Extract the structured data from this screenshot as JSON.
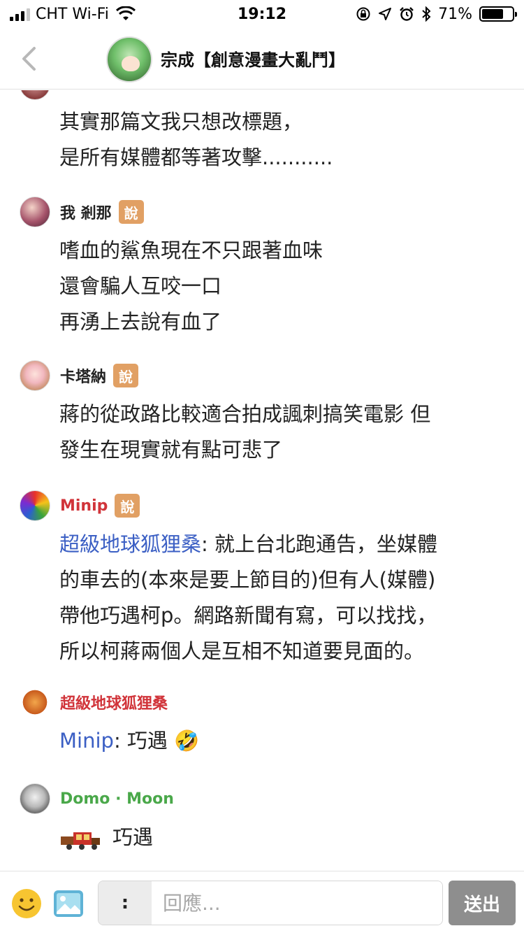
{
  "status_bar": {
    "carrier": "CHT Wi-Fi",
    "time": "19:12",
    "battery_percent": "71%",
    "battery_level": 0.71,
    "signal_bars": 3,
    "icons": [
      "signal-icon",
      "wifi-icon",
      "rotation-lock-icon",
      "location-icon",
      "alarm-icon",
      "bluetooth-icon",
      "battery-icon"
    ]
  },
  "header": {
    "title": "宗成【創意漫畫大亂鬥】",
    "back_icon": "chevron-left-icon"
  },
  "messages": [
    {
      "name": "",
      "badge": "",
      "lines": [
        "其實那篇文我只想改標題，",
        "是所有媒體都等著攻擊..........."
      ]
    },
    {
      "name": "我 剎那",
      "badge": "說",
      "lines": [
        "嗜血的鯊魚現在不只跟著血味",
        "還會騙人互咬一口",
        "再湧上去說有血了"
      ]
    },
    {
      "name": "卡塔納",
      "badge": "說",
      "lines": [
        "蔣的從政路比較適合拍成諷刺搞笑電影  但",
        "發生在現實就有點可悲了"
      ]
    },
    {
      "name": "Minip",
      "badge": "說",
      "mention": "超級地球狐狸桑",
      "lines": [
        ": 就上台北跑通告，坐媒體",
        "的車去的(本來是要上節目的)但有人(媒體)",
        "帶他巧遇柯p。網路新聞有寫，可以找找，",
        "所以柯蔣兩個人是互相不知道要見面的。"
      ]
    },
    {
      "name": "超級地球狐狸桑",
      "badge": "",
      "mention": "Minip",
      "lines": [
        ": 巧遇 🤣"
      ]
    },
    {
      "name": "Domo · Moon",
      "badge": "",
      "lines": [
        "巧遇"
      ]
    }
  ],
  "composer": {
    "prefix": ":",
    "placeholder": "回應...",
    "send_label": "送出",
    "emoji_icon": "smiley-icon",
    "image_icon": "image-icon"
  },
  "colors": {
    "badge": "#e1a064",
    "mention": "#3b5fc4",
    "name_red": "#d1343a",
    "name_green": "#4aa84a",
    "send_button": "#8e8e8e"
  }
}
